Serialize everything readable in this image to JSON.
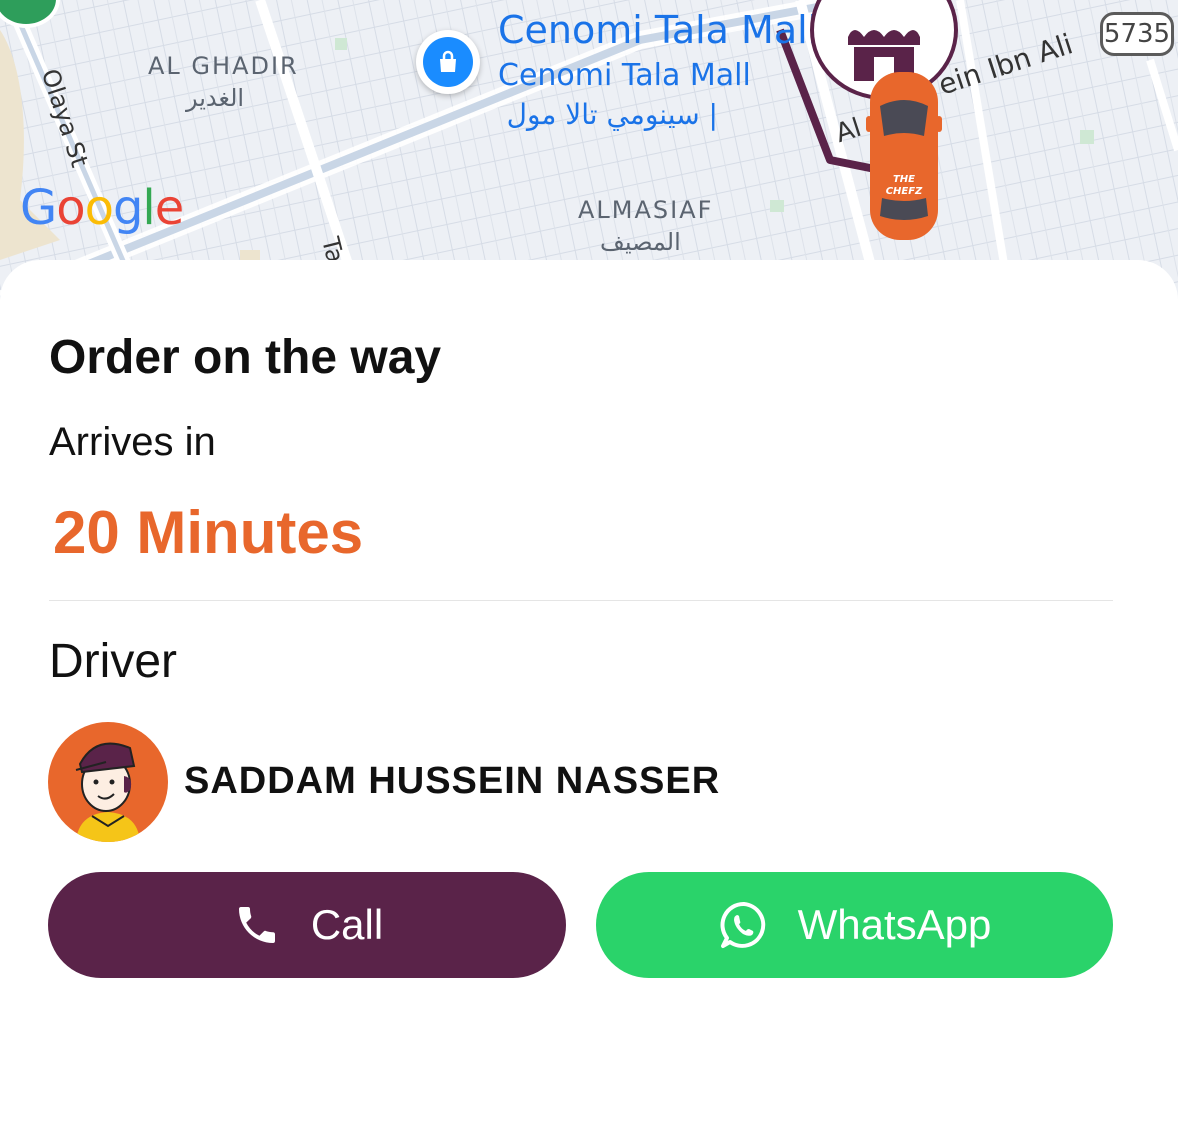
{
  "map": {
    "district_1": {
      "name_en": "AL GHADIR",
      "name_ar": "الغدير"
    },
    "district_2": {
      "name_en": "ALMASIAF",
      "name_ar": "المصيف"
    },
    "street_1": "Olaya St",
    "street_2": "Ta",
    "street_3_start": "Al",
    "street_3_end": "ein Ibn Ali",
    "poi": {
      "title": "Cenomi Tala Mall",
      "subtitle": "Cenomi Tala Mall",
      "arabic": "| سينومي تالا مول",
      "icon": "shopping-bag-icon"
    },
    "road_badge": "5735",
    "provider_logo": "Google",
    "vehicle_text_1": "THE",
    "vehicle_text_2": "CHEFZ",
    "route_color": "#5a2349"
  },
  "order": {
    "status_title": "Order on the way",
    "arrives_label": "Arrives in",
    "eta": "20 Minutes",
    "eta_color": "#e8672c"
  },
  "driver": {
    "section_label": "Driver",
    "name": "SADDAM HUSSEIN NASSER",
    "avatar_icon": "driver-avatar-illustration"
  },
  "actions": {
    "call_label": "Call",
    "call_icon": "phone-icon",
    "call_color": "#5a2349",
    "whatsapp_label": "WhatsApp",
    "whatsapp_icon": "whatsapp-icon",
    "whatsapp_color": "#2ad36a"
  }
}
